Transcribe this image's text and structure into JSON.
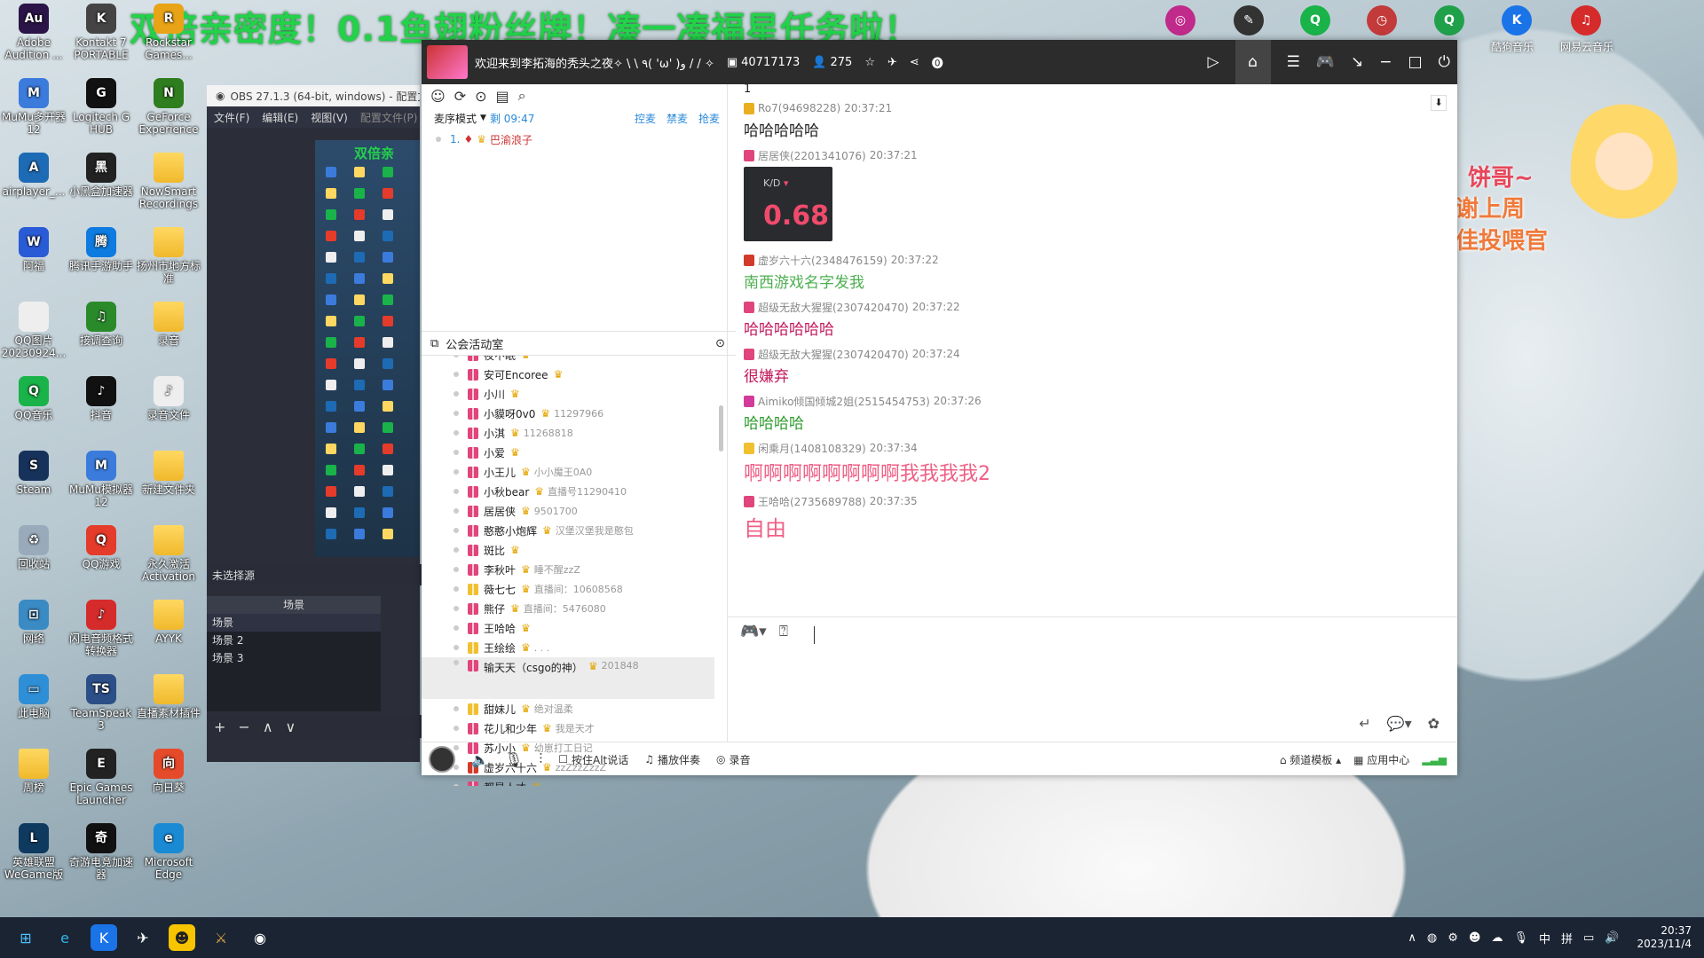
{
  "banner": "双倍亲密度！0.1鱼翅粉丝牌！凑一凑福星任务啦！",
  "desktop_left": [
    {
      "label": "Adobe Audition ...",
      "color": "#2b1447",
      "glyph": "Au"
    },
    {
      "label": "Kontakt 7 PORTABLE",
      "color": "#444",
      "glyph": "K"
    },
    {
      "label": "Rockstar Games...",
      "color": "#e8a317",
      "glyph": "R"
    },
    {
      "label": "MuMu多开器12",
      "color": "#3b7bdc",
      "glyph": "M"
    },
    {
      "label": "Logitech G HUB",
      "color": "#111",
      "glyph": "G"
    },
    {
      "label": "GeForce Experience",
      "color": "#2e7d1f",
      "glyph": "N"
    },
    {
      "label": "airplayer_...",
      "color": "#1d6bb5",
      "glyph": "A"
    },
    {
      "label": "小黑盒加速器",
      "color": "#222",
      "glyph": "黑"
    },
    {
      "label": "NowSmart Recordings",
      "color": "folder",
      "glyph": ""
    },
    {
      "label": "阿福",
      "color": "#2a5bd7",
      "glyph": "W"
    },
    {
      "label": "腾讯手游助手",
      "color": "#0d7be0",
      "glyph": "腾"
    },
    {
      "label": "扬州市地方标准",
      "color": "folder",
      "glyph": ""
    },
    {
      "label": "QQ图片20230924...",
      "color": "#eee",
      "glyph": ""
    },
    {
      "label": "接调查询",
      "color": "#2a8a2a",
      "glyph": "♫"
    },
    {
      "label": "录音",
      "color": "folder",
      "glyph": ""
    },
    {
      "label": "QQ音乐",
      "color": "#19b34a",
      "glyph": "Q"
    },
    {
      "label": "抖音",
      "color": "#111",
      "glyph": "♪"
    },
    {
      "label": "录音文件",
      "color": "#eee",
      "glyph": "♪"
    },
    {
      "label": "Steam",
      "color": "#17325a",
      "glyph": "S"
    },
    {
      "label": "MuMu模拟器12",
      "color": "#3b7bdc",
      "glyph": "M"
    },
    {
      "label": "新建文件夹",
      "color": "folder",
      "glyph": ""
    },
    {
      "label": "回收站",
      "color": "#9ab",
      "glyph": "♻"
    },
    {
      "label": "QQ游戏",
      "color": "#e53b2a",
      "glyph": "Q"
    },
    {
      "label": "永久激活 Activation",
      "color": "folder",
      "glyph": ""
    },
    {
      "label": "网络",
      "color": "#3a8ac4",
      "glyph": "⊡"
    },
    {
      "label": "闪电音频格式转换器",
      "color": "#d62b2b",
      "glyph": "♪"
    },
    {
      "label": "AYYK",
      "color": "folder",
      "glyph": ""
    },
    {
      "label": "此电脑",
      "color": "#2f8fd6",
      "glyph": "▭"
    },
    {
      "label": "TeamSpeak 3",
      "color": "#2c4f88",
      "glyph": "TS"
    },
    {
      "label": "直播素材插件",
      "color": "folder",
      "glyph": ""
    },
    {
      "label": "周榜",
      "color": "folder",
      "glyph": ""
    },
    {
      "label": "Epic Games Launcher",
      "color": "#222",
      "glyph": "E"
    },
    {
      "label": "向日葵",
      "color": "#e54a2a",
      "glyph": "向"
    },
    {
      "label": "英雄联盟 WeGame版",
      "color": "#0f3a5f",
      "glyph": "L"
    },
    {
      "label": "奇游电竞加速器",
      "color": "#111",
      "glyph": "奇"
    },
    {
      "label": "Microsoft Edge",
      "color": "#1a8ad4",
      "glyph": "e"
    }
  ],
  "desktop_top_right": [
    {
      "label": "",
      "color": "#c02a8a",
      "glyph": "◎"
    },
    {
      "label": "",
      "color": "#333",
      "glyph": "✎"
    },
    {
      "label": "",
      "color": "#19b34a",
      "glyph": "Q"
    },
    {
      "label": "",
      "color": "#c23a3a",
      "glyph": "◷"
    },
    {
      "label": "",
      "color": "#21a04a",
      "glyph": "Q"
    },
    {
      "label": "酷狗音乐",
      "color": "#1b73e8",
      "glyph": "K"
    },
    {
      "label": "网易云音乐",
      "color": "#d62b2b",
      "glyph": "♫"
    }
  ],
  "obs": {
    "title": "OBS 27.1.3 (64-bit, windows) - 配置文件",
    "menu": [
      "文件(F)",
      "编辑(E)",
      "视图(V)",
      "配置文件(P)"
    ],
    "preview_text": "双倍亲",
    "source_label": "未选择源",
    "scenes_header": "场景",
    "scenes": [
      "场景",
      "场景 2",
      "场景 3"
    ]
  },
  "app": {
    "welcome": "欢迎来到李拓海的秃头之夜✧ \\ \\ ٩( 'ω' )و / / ✧",
    "room_id": "40717173",
    "viewers": "275",
    "mode_label": "麦序模式",
    "mode_time": "剩 09:47",
    "mode_links": [
      "控麦",
      "禁麦",
      "抢麦"
    ],
    "queue": {
      "num": "1.",
      "name": "巴渝浪子"
    },
    "guild_title": "公会活动室",
    "members": [
      {
        "name": "夜不眠",
        "note": "",
        "gift": "#e0457b"
      },
      {
        "name": "安可Encoree",
        "note": "",
        "gift": "#e0457b"
      },
      {
        "name": "小川",
        "note": "",
        "gift": "#e0457b"
      },
      {
        "name": "小貘呀0v0",
        "note": "11297966",
        "gift": "#e0457b"
      },
      {
        "name": "小淇",
        "note": "11268818",
        "gift": "#e0457b"
      },
      {
        "name": "小爱",
        "note": "",
        "gift": "#e0457b"
      },
      {
        "name": "小王儿",
        "note": "小小魔王0A0",
        "gift": "#e0457b"
      },
      {
        "name": "小秋bear",
        "note": "直播号11290410",
        "gift": "#e0457b"
      },
      {
        "name": "居居侠",
        "note": "9501700",
        "gift": "#e0457b"
      },
      {
        "name": "憨憨小炮辉",
        "note": "汉堡汉堡我是憨包",
        "gift": "#e0457b"
      },
      {
        "name": "斑比",
        "note": "",
        "gift": "#e0457b"
      },
      {
        "name": "李秋叶",
        "note": "睡不醒zzZ",
        "gift": "#e0457b"
      },
      {
        "name": "薇七七",
        "note": "直播间：10608568",
        "gift": "#f0c030"
      },
      {
        "name": "熊仔",
        "note": "直播间：5476080",
        "gift": "#e0457b"
      },
      {
        "name": "王哈哈",
        "note": "",
        "gift": "#e0457b"
      },
      {
        "name": "王绘绘",
        "note": ". . .",
        "gift": "#f0c030"
      },
      {
        "name": "输天天（csgo的神）",
        "note": "201848",
        "gift": "#e0457b"
      },
      {
        "name": "甜妹儿",
        "note": "绝对温柔",
        "gift": "#f0c030"
      },
      {
        "name": "花儿和少年",
        "note": "我是天才",
        "gift": "#e0457b"
      },
      {
        "name": "苏小小",
        "note": "幼崽打工日记",
        "gift": "#e0457b"
      },
      {
        "name": "虚岁六十六",
        "note": "zzZzzZzzZ",
        "gift": "#d23b2b"
      },
      {
        "name": "都是人才",
        "note": "",
        "gift": "#e0457b"
      }
    ],
    "chat_top_line": "1",
    "messages": [
      {
        "user": "Ro7(94698228)",
        "time": "20:37:21",
        "text": "哈哈哈哈哈",
        "color": "#222",
        "icon": "#e8b020",
        "size": "17px"
      },
      {
        "user": "居居侠(2201341076)",
        "time": "20:37:21",
        "text": "",
        "color": "#222",
        "icon": "#e0457b",
        "kd": {
          "label": "K/D",
          "value": "0.68"
        }
      },
      {
        "user": "虚岁六十六(2348476159)",
        "time": "20:37:22",
        "text": "南西游戏名字发我",
        "color": "#4caf50",
        "icon": "#d23b2b",
        "size": "17px"
      },
      {
        "user": "超级无敌大猩猩(2307420470)",
        "time": "20:37:22",
        "text": "哈哈哈哈哈哈",
        "color": "#c2185b",
        "icon": "#e0457b",
        "size": "17px"
      },
      {
        "user": "超级无敌大猩猩(2307420470)",
        "time": "20:37:24",
        "text": "很嫌弃",
        "color": "#c2185b",
        "icon": "#e0457b",
        "size": "17px"
      },
      {
        "user": "Aimiko倾国倾城2姐(2515454753)",
        "time": "20:37:26",
        "text": "哈哈哈哈",
        "color": "#2e9b2e",
        "icon": "#d23b9b",
        "size": "17px"
      },
      {
        "user": "闲乘月(1408108329)",
        "time": "20:37:34",
        "text": "啊啊啊啊啊啊啊啊我我我我2",
        "color": "#ef5f86",
        "icon": "#f0c030",
        "size": "22px"
      },
      {
        "user": "王哈哈(2735689788)",
        "time": "20:37:35",
        "text": "自由",
        "color": "#ef5f86",
        "icon": "#e0457b",
        "size": "24px"
      }
    ],
    "bottom": {
      "ptt": "按住Alt说话",
      "accompany": "播放伴奏",
      "record": "录音",
      "channel_template": "频道模板",
      "app_center": "应用中心"
    }
  },
  "badge": {
    "line1": "饼哥~",
    "line2": "感谢上周",
    "line3": "最佳投喂官"
  },
  "taskbar": {
    "time": "20:37",
    "date": "2023/11/4",
    "ime1": "中",
    "ime2": "拼"
  }
}
